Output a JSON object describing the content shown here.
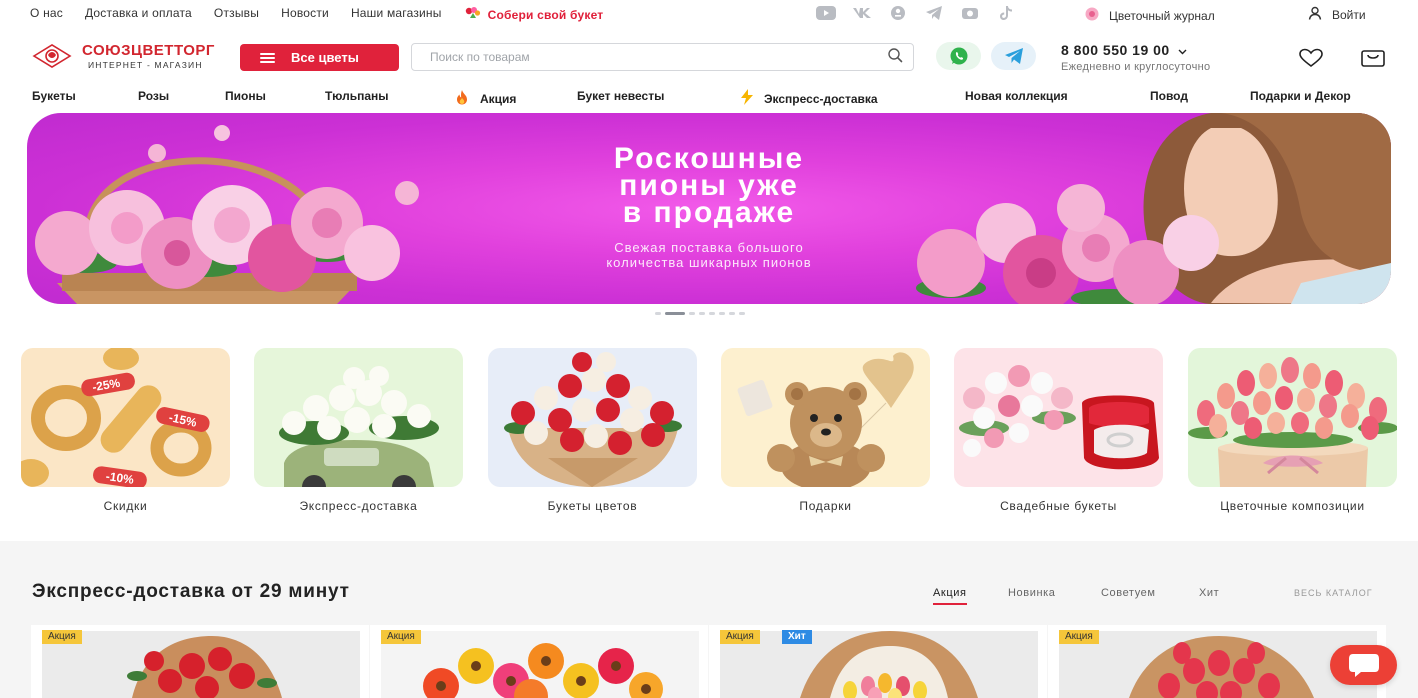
{
  "topbar": {
    "links": [
      "О нас",
      "Доставка и оплата",
      "Отзывы",
      "Новости",
      "Наши магазины"
    ],
    "bouquet_link": "Собери свой букет",
    "socials": [
      "youtube-icon",
      "vk-icon",
      "ok-icon",
      "telegram-icon",
      "camera-icon",
      "tiktok-icon"
    ],
    "journal": "Цветочный журнал",
    "login": "Войти"
  },
  "header": {
    "logo_title": "СОЮЗЦВЕТТОРГ",
    "logo_sub": "ИНТЕРНЕТ - МАГАЗИН",
    "catalog_button": "Все цветы",
    "search_placeholder": "Поиск по товарам",
    "phone": "8 800 550 19 00",
    "phone_sub": "Ежедневно и круглосуточно"
  },
  "mainnav": [
    "Букеты",
    "Розы",
    "Пионы",
    "Тюльпаны",
    "Акция",
    "Букет невесты",
    "Экспресс-доставка",
    "Новая коллекция",
    "Повод",
    "Подарки и Декор"
  ],
  "hero": {
    "title_lines": [
      "Роскошные",
      "пионы уже",
      "в продаже"
    ],
    "subtitle_lines": [
      "Свежая поставка большого",
      "количества шикарных пионов"
    ],
    "slides": 8,
    "active_slide": 2
  },
  "categories": [
    "Скидки",
    "Экспресс-доставка",
    "Букеты цветов",
    "Подарки",
    "Свадебные букеты",
    "Цветочные композиции"
  ],
  "discount_tags": [
    "-25%",
    "-15%",
    "-10%"
  ],
  "products_section": {
    "title": "Экспресс-доставка от 29 минут",
    "tabs": [
      "Акция",
      "Новинка",
      "Советуем",
      "Хит"
    ],
    "active_tab": "Акция",
    "all_link": "ВЕСЬ КАТАЛОГ",
    "cards": [
      {
        "badges": [
          "Акция"
        ]
      },
      {
        "badges": [
          "Акция"
        ]
      },
      {
        "badges": [
          "Акция",
          "Хит"
        ]
      },
      {
        "badges": [
          "Акция"
        ]
      }
    ]
  },
  "colors": {
    "accent": "#e0223b",
    "badge_sale": "#f5c63a",
    "badge_hit": "#2e8be4",
    "hero_bg": "#e141dd",
    "chat": "#ec4036"
  }
}
